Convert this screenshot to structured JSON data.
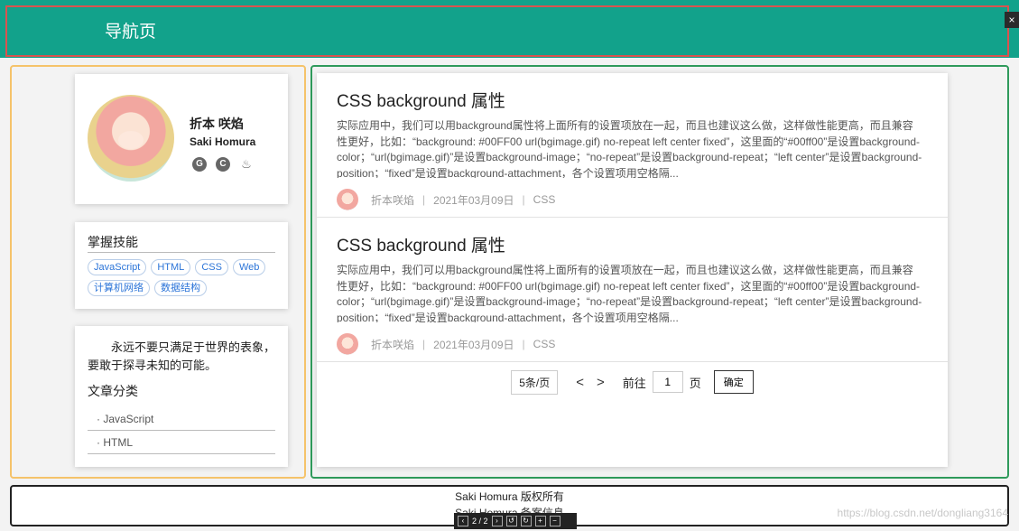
{
  "header": {
    "title": "导航页",
    "close_icon": "×"
  },
  "profile": {
    "name": "折本 咲焰",
    "english_name": "Saki Homura",
    "icons": [
      "github-icon",
      "csdn-icon",
      "juejin-icon"
    ],
    "icon_glyphs": [
      "G",
      "C",
      "♨"
    ]
  },
  "skills": {
    "title": "掌握技能",
    "tags": [
      "JavaScript",
      "HTML",
      "CSS",
      "Web",
      "计算机网络",
      "数据结构"
    ]
  },
  "quote": "永远不要只满足于世界的表象，要敢于探寻未知的可能。",
  "categories": {
    "title": "文章分类",
    "items": [
      "· JavaScript",
      "· HTML"
    ]
  },
  "articles": [
    {
      "title": "CSS background 属性",
      "excerpt": "实际应用中，我们可以用background属性将上面所有的设置项放在一起，而且也建议这么做，这样做性能更高，而且兼容性更好，比如：“background: #00FF00 url(bgimage.gif) no-repeat left center fixed”，这里面的“#00ff00”是设置background-color；“url(bgimage.gif)”是设置background-image；“no-repeat”是设置background-repeat；“left center”是设置background-position；“fixed”是设置background-attachment，各个设置项用空格隔...",
      "author": "折本咲焰",
      "date": "2021年03月09日",
      "tag": "CSS"
    },
    {
      "title": "CSS background 属性",
      "excerpt": "实际应用中，我们可以用background属性将上面所有的设置项放在一起，而且也建议这么做，这样做性能更高，而且兼容性更好，比如：“background: #00FF00 url(bgimage.gif) no-repeat left center fixed”，这里面的“#00ff00”是设置background-color；“url(bgimage.gif)”是设置background-image；“no-repeat”是设置background-repeat；“left center”是设置background-position；“fixed”是设置background-attachment，各个设置项用空格隔...",
      "author": "折本咲焰",
      "date": "2021年03月09日",
      "tag": "CSS"
    }
  ],
  "pagination": {
    "page_size": "5条/页",
    "prev": "<",
    "next": ">",
    "goto_label": "前往",
    "page_value": "1",
    "page_suffix": "页",
    "confirm": "确定"
  },
  "footer": {
    "line1": "Saki Homura 版权所有",
    "line2": "Saki Homura 备案信息"
  },
  "pdf_toolbar": {
    "page": "2 / 2"
  },
  "watermark": "https://blog.csdn.net/dongliang3164"
}
